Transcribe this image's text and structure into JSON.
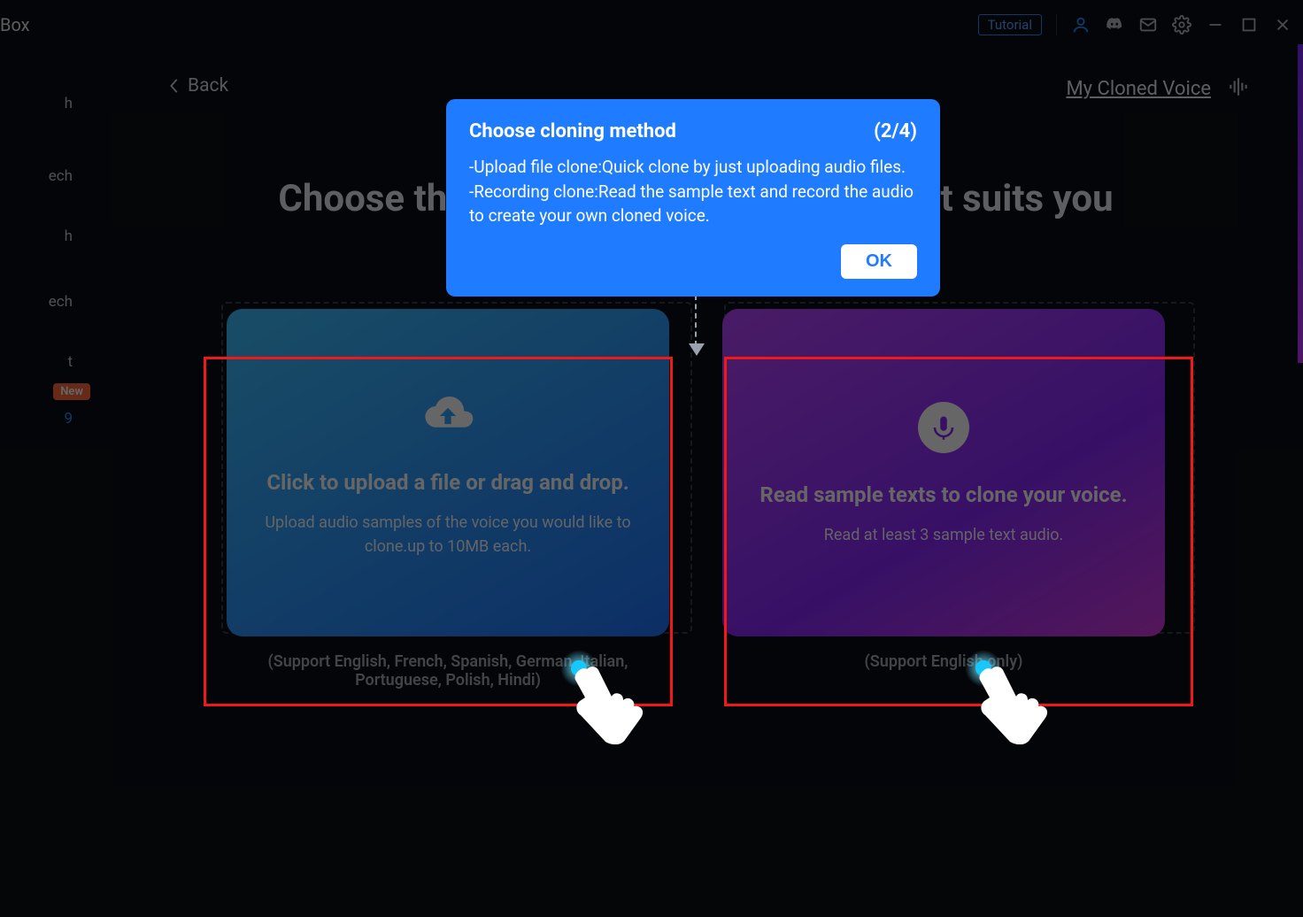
{
  "titlebar": {
    "app_title": "Box",
    "tutorial": "Tutorial"
  },
  "sidebar": {
    "items": [
      "h",
      "ech",
      "h",
      "ech",
      "t",
      "9"
    ],
    "new_badge": "New"
  },
  "header": {
    "back": "Back",
    "my_cloned": "My Cloned Voice",
    "page_heading": "Choose the method of voice cloning that suits you"
  },
  "tooltip": {
    "title": "Choose cloning method",
    "step": "(2/4)",
    "line1": "-Upload file clone:Quick clone by just uploading audio files.",
    "line2": "-Recording clone:Read the sample text and record the audio to create your own cloned voice.",
    "ok": "OK"
  },
  "card_upload": {
    "title": "Click to upload a file or drag and drop.",
    "sub": "Upload audio samples of the voice you would like to clone.up to 10MB each.",
    "support": "(Support English, French, Spanish, German, Italian, Portuguese, Polish, Hindi)"
  },
  "card_record": {
    "title": "Read sample texts to clone your voice.",
    "sub": "Read at least 3 sample text audio.",
    "support": "(Support English only)"
  }
}
